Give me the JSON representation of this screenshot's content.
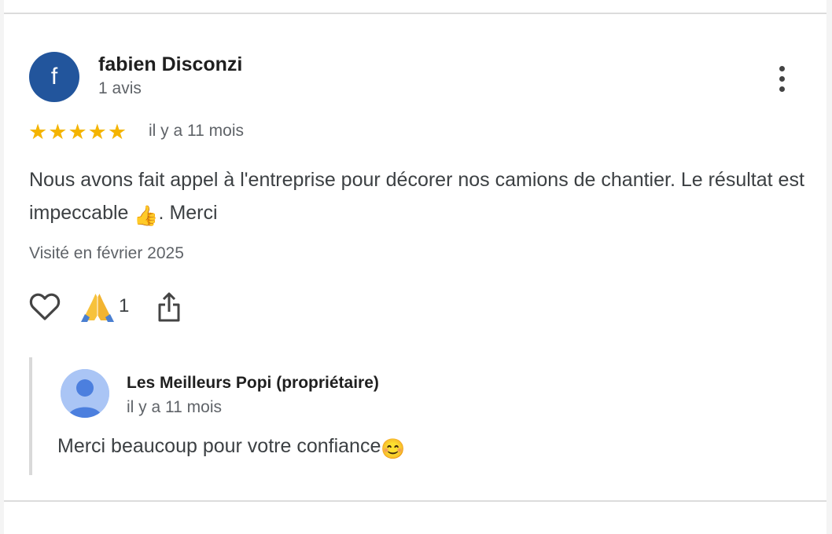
{
  "review": {
    "avatar_letter": "f",
    "author": "fabien Disconzi",
    "meta": "1 avis",
    "rating": 5,
    "date": "il y a 11 mois",
    "text_part1": "Nous avons fait appel à l'entreprise pour décorer nos camions de chantier. Le résultat est impeccable ",
    "text_emoji": "👍",
    "text_part2": ". Merci",
    "visit": "Visité en février 2025",
    "reaction_count": "1"
  },
  "owner_reply": {
    "author": "Les Meilleurs Popi (propriétaire)",
    "date": "il y a 11 mois",
    "text": "Merci beaucoup pour votre confiance",
    "text_emoji": "😊"
  },
  "icons": {
    "more": "more-vert-icon",
    "like": "heart-icon",
    "reaction": "praying-hands-icon",
    "share": "share-icon",
    "star": "star-icon"
  },
  "colors": {
    "avatar": "#22559c",
    "star": "#f4b400",
    "owner_avatar": "#aac5f5"
  }
}
